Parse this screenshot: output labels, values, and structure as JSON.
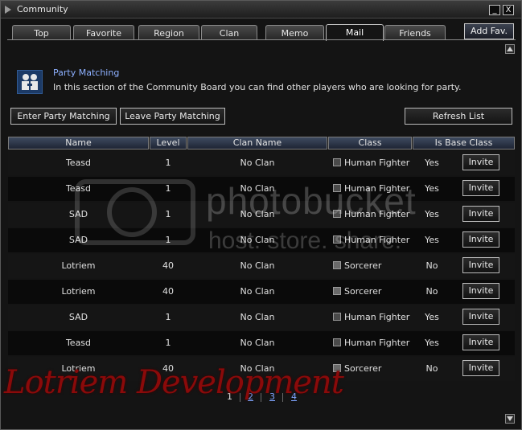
{
  "window": {
    "title": "Community",
    "minimize_label": "_",
    "close_label": "X"
  },
  "tabs": [
    {
      "label": "Top"
    },
    {
      "label": "Favorite"
    },
    {
      "label": "Region"
    },
    {
      "label": "Clan"
    },
    {
      "label": "Memo"
    },
    {
      "label": "Mail"
    },
    {
      "label": "Friends"
    }
  ],
  "active_tab": "Mail",
  "add_fav_label": "Add Fav.",
  "info": {
    "title": "Party Matching",
    "description": "In this section of the Community Board you can find other players who are looking for party.",
    "icon": "party-matching-icon"
  },
  "buttons": {
    "enter": "Enter Party Matching",
    "leave": "Leave Party Matching",
    "refresh": "Refresh List"
  },
  "table": {
    "headers": [
      "Name",
      "Level",
      "Clan Name",
      "Class",
      "Is Base Class"
    ],
    "rows": [
      {
        "name": "Teasd",
        "level": "1",
        "clan": "No Clan",
        "class": "Human Fighter",
        "class_icon": "fighter-icon",
        "base": "Yes",
        "action": "Invite"
      },
      {
        "name": "Teasd",
        "level": "1",
        "clan": "No Clan",
        "class": "Human Fighter",
        "class_icon": "fighter-icon",
        "base": "Yes",
        "action": "Invite"
      },
      {
        "name": "SAD",
        "level": "1",
        "clan": "No Clan",
        "class": "Human Fighter",
        "class_icon": "fighter-icon",
        "base": "Yes",
        "action": "Invite"
      },
      {
        "name": "SAD",
        "level": "1",
        "clan": "No Clan",
        "class": "Human Fighter",
        "class_icon": "fighter-icon",
        "base": "Yes",
        "action": "Invite"
      },
      {
        "name": "Lotriem",
        "level": "40",
        "clan": "No Clan",
        "class": "Sorcerer",
        "class_icon": "mage-icon",
        "base": "No",
        "action": "Invite"
      },
      {
        "name": "Lotriem",
        "level": "40",
        "clan": "No Clan",
        "class": "Sorcerer",
        "class_icon": "mage-icon",
        "base": "No",
        "action": "Invite"
      },
      {
        "name": "SAD",
        "level": "1",
        "clan": "No Clan",
        "class": "Human Fighter",
        "class_icon": "fighter-icon",
        "base": "Yes",
        "action": "Invite"
      },
      {
        "name": "Teasd",
        "level": "1",
        "clan": "No Clan",
        "class": "Human Fighter",
        "class_icon": "fighter-icon",
        "base": "Yes",
        "action": "Invite"
      },
      {
        "name": "Lotriem",
        "level": "40",
        "clan": "No Clan",
        "class": "Sorcerer",
        "class_icon": "mage-icon",
        "base": "No",
        "action": "Invite"
      }
    ]
  },
  "pagination": {
    "pages": [
      "1",
      "2",
      "3",
      "4"
    ],
    "current": "1"
  },
  "overlay": {
    "watermark": "photobucket",
    "watermark_sub": "host. store. share.",
    "signature": "Lotriem Development"
  },
  "colors": {
    "link": "#7fa4ff",
    "signature": "#8a0a0a",
    "header_bg": "#2e3a50"
  }
}
